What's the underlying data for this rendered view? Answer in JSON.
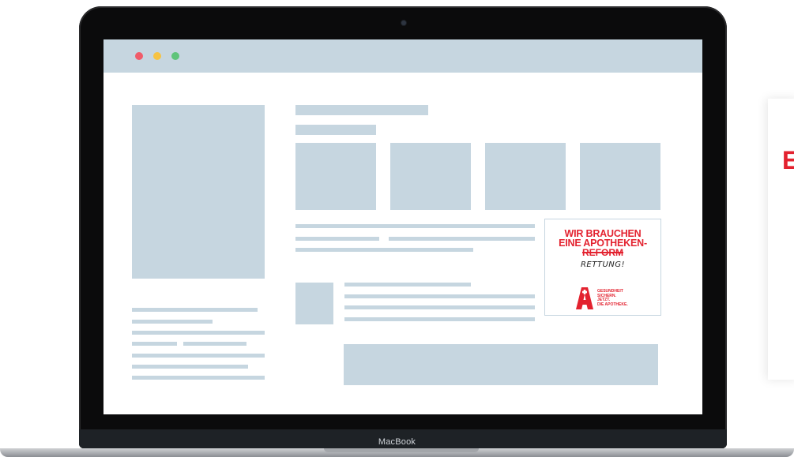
{
  "laptop": {
    "brand_label": "MacBook"
  },
  "browser": {
    "window_controls": {
      "close_color": "#f05c6a",
      "minimize_color": "#f6c343",
      "zoom_color": "#5fc47a"
    }
  },
  "ad": {
    "headline_line1": "WIR BRAUCHEN",
    "headline_line2": "EINE APOTHEKEN-",
    "struck_word": "REFORM",
    "handwritten_word": "RETTUNG!",
    "slogan_line1": "GESUNDHEIT",
    "slogan_line2": "SICHERN.",
    "slogan_line3": "JETZT.",
    "slogan_line4": "DIE APOTHEKE.",
    "brand_color": "#e3222f",
    "logo_icon": "apotheke-a-logo-icon"
  },
  "side_card": {
    "visible_letter": "E"
  },
  "colors": {
    "placeholder": "#c6d6e0",
    "accent": "#e3222f"
  }
}
